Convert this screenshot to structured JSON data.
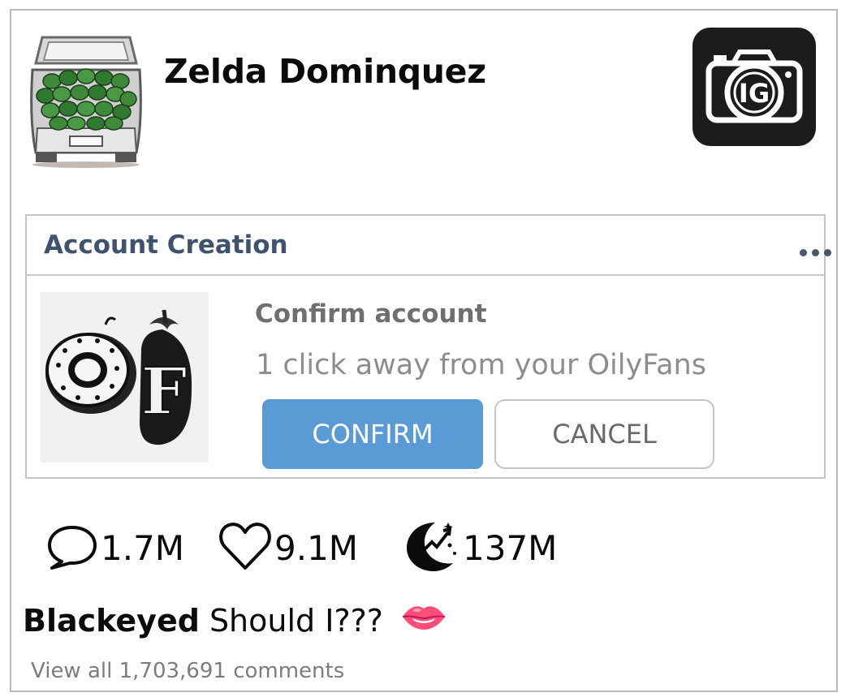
{
  "post": {
    "username": "Zelda Dominquez",
    "avatar_icon": "car-trunk-full-of-watermelons-icon",
    "header_app_icon": "ig-camera-icon",
    "header_app_label": "IG"
  },
  "notification": {
    "title": "Account Creation",
    "menu_icon": "more-dots-icon",
    "app_logo_icon": "oilyfans-of-logo-icon",
    "app_logo_text": "OF",
    "heading": "Confirm account",
    "message": "1 click away from your OilyFans",
    "confirm_label": "CONFIRM",
    "cancel_label": "CANCEL",
    "colors": {
      "confirm": "#5a9bd6",
      "title": "#3f536e"
    }
  },
  "stats": {
    "comments": {
      "icon": "speech-bubble-icon",
      "value": "1.7M"
    },
    "likes": {
      "icon": "heart-icon",
      "value": "9.1M"
    },
    "trend": {
      "icon": "moon-trending-icon",
      "value": "137M"
    }
  },
  "caption": {
    "author": "Blackeyed",
    "text": "Should I???",
    "emoji_icon": "lips-biting-icon"
  },
  "comments_link": "View all 1,703,691 comments"
}
